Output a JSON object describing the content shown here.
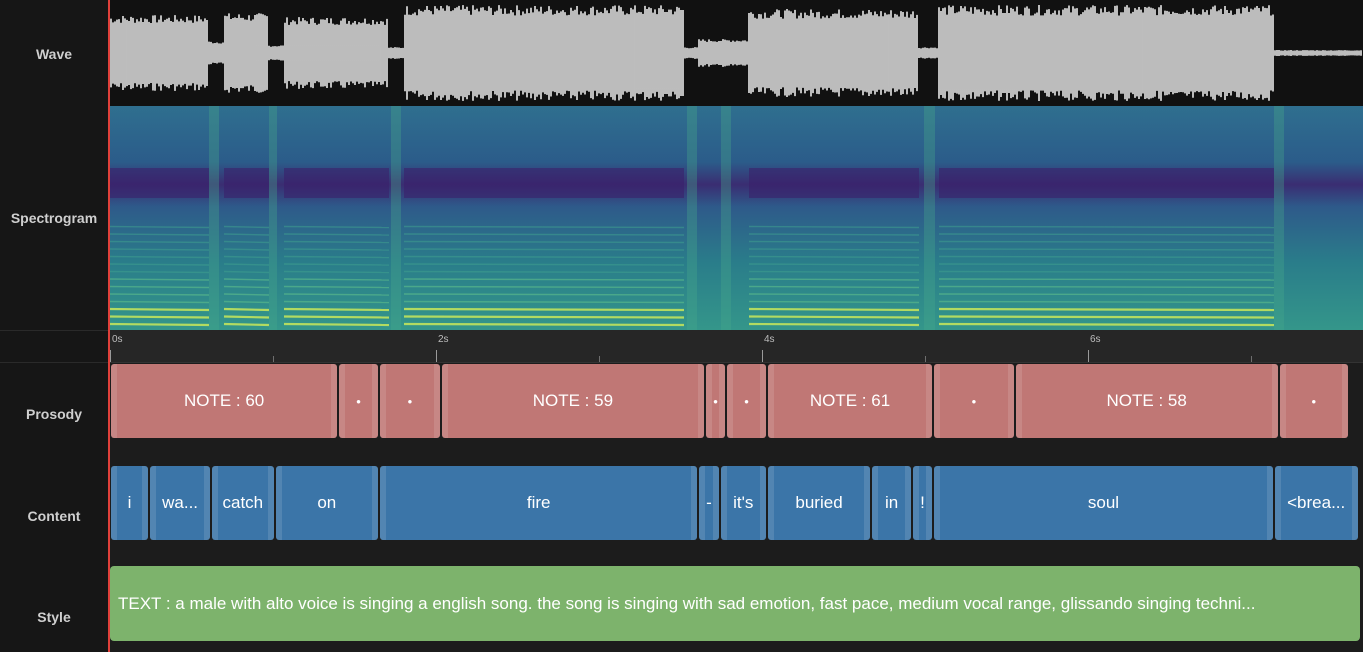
{
  "tracks": {
    "wave": "Wave",
    "spectrogram": "Spectrogram",
    "prosody": "Prosody",
    "content": "Content",
    "style": "Style"
  },
  "ruler": {
    "duration_seconds": 7.7,
    "ticks": [
      {
        "t": 0,
        "label": "0s"
      },
      {
        "t": 2,
        "label": "2s"
      },
      {
        "t": 4,
        "label": "4s"
      },
      {
        "t": 6,
        "label": "6s"
      }
    ]
  },
  "prosody": [
    {
      "start": 0.0,
      "end": 1.4,
      "label": "NOTE : 60"
    },
    {
      "start": 1.4,
      "end": 1.65,
      "label": "•"
    },
    {
      "start": 1.65,
      "end": 2.03,
      "label": "•"
    },
    {
      "start": 2.03,
      "end": 3.65,
      "label": "NOTE : 59"
    },
    {
      "start": 3.65,
      "end": 3.78,
      "label": "•"
    },
    {
      "start": 3.78,
      "end": 4.03,
      "label": "•"
    },
    {
      "start": 4.03,
      "end": 5.05,
      "label": "NOTE : 61"
    },
    {
      "start": 5.05,
      "end": 5.55,
      "label": "•"
    },
    {
      "start": 5.55,
      "end": 7.17,
      "label": "NOTE : 58"
    },
    {
      "start": 7.17,
      "end": 7.6,
      "label": "•"
    }
  ],
  "content": [
    {
      "start": 0.0,
      "end": 0.24,
      "label": "i"
    },
    {
      "start": 0.24,
      "end": 0.62,
      "label": "wa..."
    },
    {
      "start": 0.62,
      "end": 1.01,
      "label": "catch"
    },
    {
      "start": 1.01,
      "end": 1.65,
      "label": "on"
    },
    {
      "start": 1.65,
      "end": 3.61,
      "label": "fire"
    },
    {
      "start": 3.61,
      "end": 3.74,
      "label": "-"
    },
    {
      "start": 3.74,
      "end": 4.03,
      "label": "it's"
    },
    {
      "start": 4.03,
      "end": 4.67,
      "label": "buried"
    },
    {
      "start": 4.67,
      "end": 4.92,
      "label": "in"
    },
    {
      "start": 4.92,
      "end": 5.05,
      "label": "!"
    },
    {
      "start": 5.05,
      "end": 7.14,
      "label": "soul"
    },
    {
      "start": 7.14,
      "end": 7.66,
      "label": "<brea..."
    }
  ],
  "style": {
    "text": "TEXT : a male with alto voice is singing a english song. the song is singing with sad emotion, fast pace, medium vocal range, glissando singing techni..."
  },
  "colors": {
    "prosody": "#c07775",
    "content": "#3b75a8",
    "style": "#7db36c",
    "playhead": "#e0403a"
  }
}
